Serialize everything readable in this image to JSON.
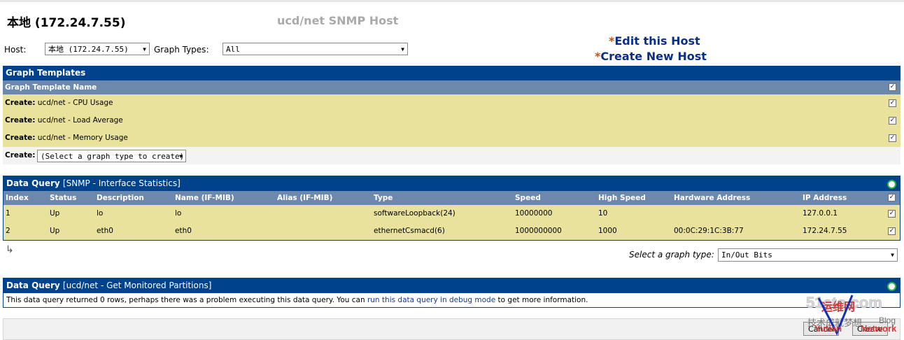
{
  "header": {
    "title": "本地 (172.24.7.55)",
    "subtitle": "ucd/net SNMP Host",
    "edit_link": "Edit this Host",
    "create_link": "Create New Host",
    "link_marker": "*"
  },
  "filter": {
    "host_label": "Host:",
    "host_value": "本地 (172.24.7.55)",
    "graph_types_label": "Graph Types:",
    "graph_types_value": "All"
  },
  "graph_templates": {
    "title": "Graph Templates",
    "column_header": "Graph Template Name",
    "create_prefix": "Create:",
    "items": [
      {
        "name": "ucd/net - CPU Usage"
      },
      {
        "name": "ucd/net - Load Average"
      },
      {
        "name": "ucd/net - Memory Usage"
      }
    ],
    "create_label": "Create:",
    "create_select": "(Select a graph type to create)"
  },
  "dq_interfaces": {
    "title_bold": "Data Query",
    "title_rest": "[SNMP - Interface Statistics]",
    "columns": [
      "Index",
      "Status",
      "Description",
      "Name (IF-MIB)",
      "Alias (IF-MIB)",
      "Type",
      "Speed",
      "High Speed",
      "Hardware Address",
      "IP Address"
    ],
    "rows": [
      [
        "1",
        "Up",
        "lo",
        "lo",
        "",
        "softwareLoopback(24)",
        "10000000",
        "10",
        "",
        "127.0.0.1"
      ],
      [
        "2",
        "Up",
        "eth0",
        "eth0",
        "",
        "ethernetCsmacd(6)",
        "1000000000",
        "1000",
        "00:0C:29:1C:3B:77",
        "172.24.7.55"
      ]
    ],
    "graph_type_label": "Select a graph type:",
    "graph_type_value": "In/Out Bits"
  },
  "dq_partitions": {
    "title_bold": "Data Query",
    "title_rest": "[ucd/net - Get Monitored Partitions]",
    "msg_before": "This data query returned 0 rows, perhaps there was a problem executing this data query. You can",
    "msg_link": "run this data query in debug mode",
    "msg_after": "to get more information."
  },
  "actions": {
    "cancel": "Cancel",
    "create": "Create"
  },
  "watermark": {
    "site": "51cto.com",
    "brand": "运维网",
    "tag": "技术成就梦想",
    "blog": "Blog",
    "yutian": "Yutian",
    "network": "Network"
  },
  "colors": {
    "header_bg": "#00438c",
    "subheader_bg": "#6d88ad",
    "row_bg": "#e8e29c",
    "link_blue": "#0b2f86",
    "link_marker": "#c5501b"
  }
}
